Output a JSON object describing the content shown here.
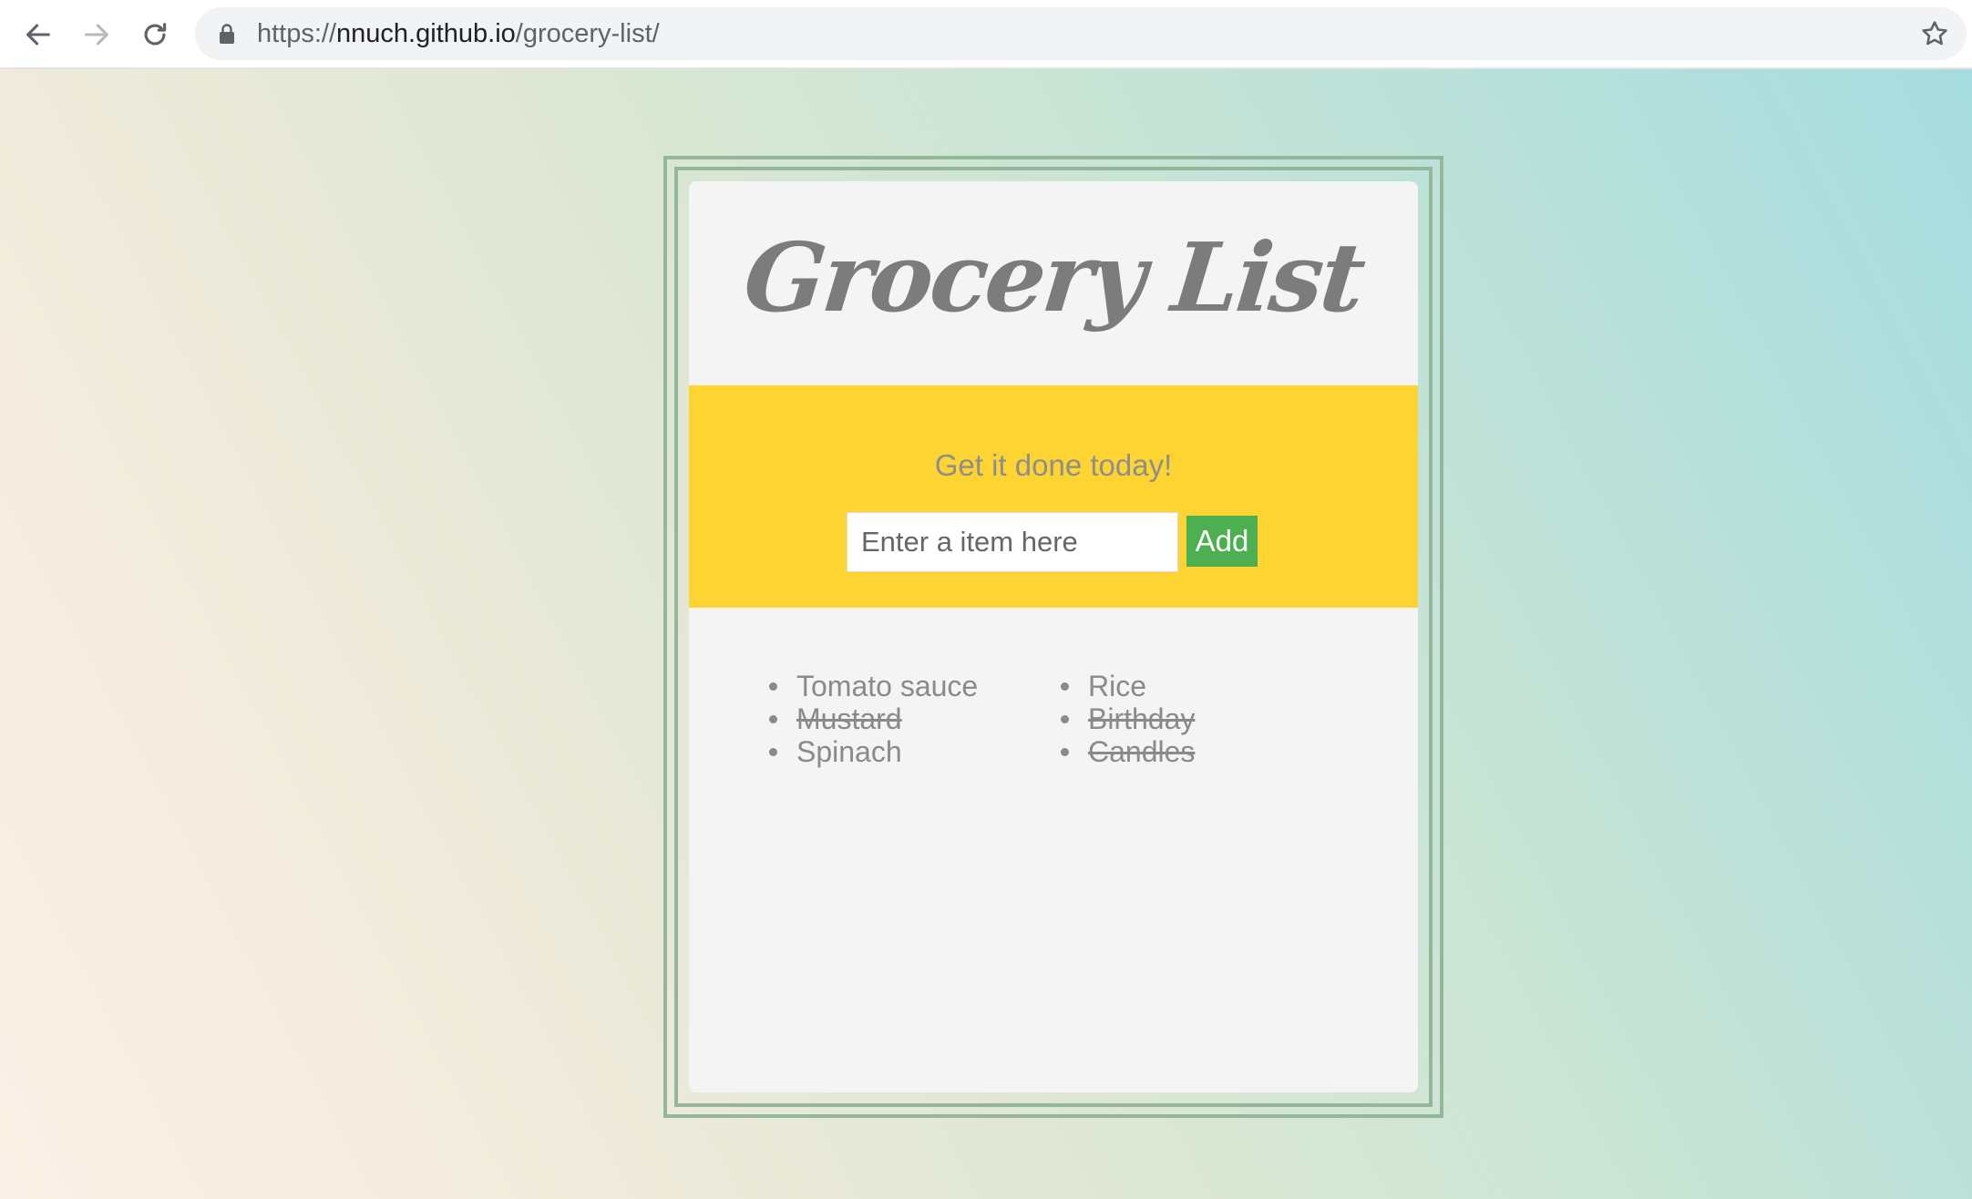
{
  "browser": {
    "url_scheme": "https://",
    "url_host": "nnuch.github.io",
    "url_path": "/grocery-list/",
    "icons": [
      "back-arrow-icon",
      "forward-arrow-icon",
      "reload-icon",
      "lock-icon",
      "bookmark-star-icon"
    ]
  },
  "app": {
    "title": "Grocery List",
    "tagline": "Get it done today!",
    "input_placeholder": "Enter a item here",
    "input_value": "",
    "add_label": "Add"
  },
  "items": [
    {
      "label": "Tomato sauce",
      "done": false
    },
    {
      "label": "Mustard",
      "done": true
    },
    {
      "label": "Spinach",
      "done": false
    },
    {
      "label": "Rice",
      "done": false
    },
    {
      "label": "Birthday",
      "done": true
    },
    {
      "label": "Candles",
      "done": true
    }
  ],
  "colors": {
    "band": "#fdd431",
    "add_button": "#4caf50",
    "frame": "#94b79c",
    "card": "#f4f4f4",
    "text": "#8a8a8a"
  }
}
